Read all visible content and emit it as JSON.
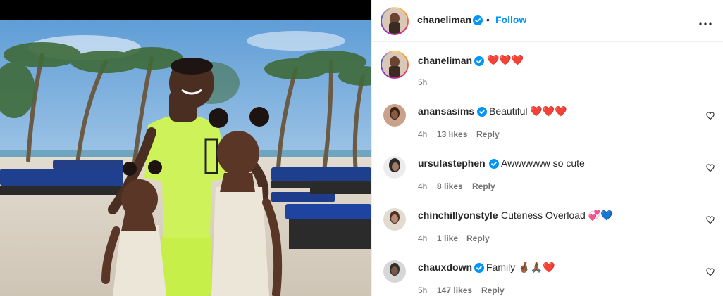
{
  "post": {
    "author": "chaneliman",
    "follow_label": "Follow",
    "separator": "•",
    "caption_text": "❤️❤️❤️",
    "caption_time": "5h"
  },
  "comments": [
    {
      "user": "anansasims",
      "verified": true,
      "text": "Beautiful ❤️❤️❤️",
      "time": "4h",
      "likes": "13 likes",
      "reply": "Reply"
    },
    {
      "user": "ursulastephen",
      "verified": true,
      "text": "Awwwwww so cute",
      "time": "4h",
      "likes": "8 likes",
      "reply": "Reply"
    },
    {
      "user": "chinchillyonstyle",
      "verified": false,
      "text": "Cuteness Overload 💞💙",
      "time": "4h",
      "likes": "1 like",
      "reply": "Reply"
    },
    {
      "user": "chauxdown",
      "verified": true,
      "text": "Family 🤞🏾🙏🏾❤️",
      "time": "5h",
      "likes": "147 likes",
      "reply": "Reply"
    }
  ],
  "icons": {
    "verified": "verified-badge-icon",
    "more": "more-options-icon",
    "like": "heart-outline-icon"
  },
  "colors": {
    "accent": "#0095f6",
    "verified": "#0095f6",
    "muted": "#737373",
    "text": "#262626"
  }
}
